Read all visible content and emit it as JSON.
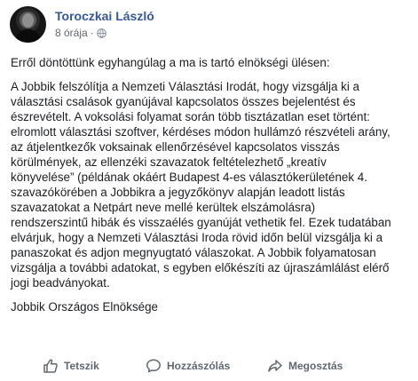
{
  "post": {
    "author": "Toroczkai László",
    "time": "8 órája",
    "separator": "·",
    "paragraphs": [
      {
        "lines": [
          "Erről döntöttünk egyhangúlag a ma is tartó elnökségi ülésen:"
        ]
      },
      {
        "lines": [
          "A Jobbik felszólítja a Nemzeti Választási Irodát, hogy vizsgálja ki a",
          "választási csalások gyanújával kapcsolatos összes bejelentést és",
          "észrevételt. A voksolási folyamat során több tisztázatlan eset történt:",
          "elromlott választási szoftver, kérdéses módon hullámzó részvételi arány,",
          "az átjelentkezők voksainak ellenőrzésével kapcsolatos visszás",
          "körülmények, az ellenzéki szavazatok feltételezhető „kreatív",
          "könyvelése” (példának okáért Budapest 4-es választókerületének 4.",
          "szavazókörében a Jobbikra a jegyzőkönyv alapján leadott listás",
          "szavazatokat a Netpárt neve mellé kerültek elszámolásra)",
          "rendszerszintű hibák és visszaélés gyanúját vethetik fel. Ezek tudatában",
          "elvárjuk, hogy a Nemzeti Választási Iroda rövid időn belül vizsgálja ki a",
          "panaszokat és adjon megnyugtató válaszokat. A Jobbik folyamatosan",
          "vizsgálja a további adatokat, s egyben előkészíti az újraszámlálást elérő",
          "jogi beadványokat."
        ]
      },
      {
        "lines": [
          "Jobbik Országos Elnöksége"
        ]
      }
    ]
  },
  "actions": {
    "like_label": "Tetszik",
    "comment_label": "Hozzászólás",
    "share_label": "Megosztás"
  },
  "colors": {
    "author": "#365899",
    "text": "#1c1e21",
    "meta": "#616770",
    "action": "#606770"
  },
  "icons": {
    "privacy": "globe-icon",
    "like": "thumbs-up-icon",
    "comment": "speech-bubble-icon",
    "share": "share-arrow-icon"
  }
}
